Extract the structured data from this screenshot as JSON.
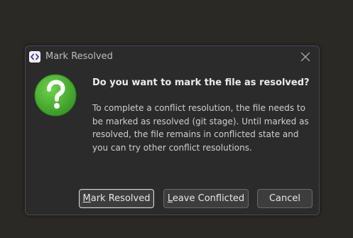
{
  "dialog": {
    "title": "Mark Resolved",
    "app_icon": "code-brackets-icon",
    "close_icon": "close-icon",
    "heading": "Do you want to mark the file as resolved?",
    "message": "To complete a conflict resolution, the file needs to be marked as resolved (git stage). Until marked as resolved, the file remains in conflicted state and you can try other conflict resolutions.",
    "question_icon": "question-icon",
    "question_icon_color": "#4cae34"
  },
  "buttons": {
    "mark_resolved": {
      "accel": "M",
      "rest": "ark Resolved"
    },
    "leave_conflicted": {
      "accel": "L",
      "rest": "eave Conflicted"
    },
    "cancel": {
      "label": "Cancel"
    }
  },
  "colors": {
    "backdrop": "#2a2925",
    "dialog_bg": "#2b2b2b",
    "button_bg": "#3d3d3d"
  }
}
